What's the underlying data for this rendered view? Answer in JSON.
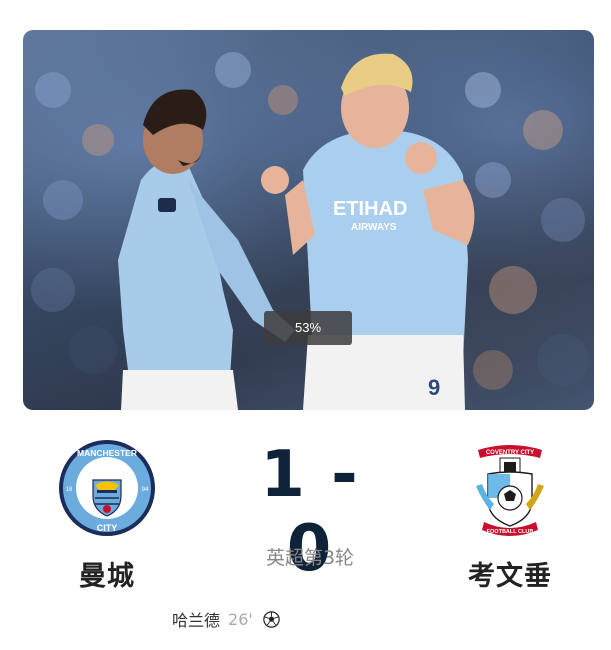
{
  "photo": {
    "progress_label": "53%"
  },
  "match": {
    "home": {
      "name": "曼城",
      "badge_icon": "manchester-city-crest"
    },
    "away": {
      "name": "考文垂",
      "badge_icon": "coventry-city-crest"
    },
    "score": "1 - 0",
    "round": "英超第3轮"
  },
  "events": [
    {
      "player": "哈兰德",
      "minute": "26'",
      "icon": "football-icon"
    }
  ],
  "colors": {
    "score_text": "#0e2238",
    "city_blue": "#6cabdd",
    "coventry_blue": "#5db1e4"
  }
}
